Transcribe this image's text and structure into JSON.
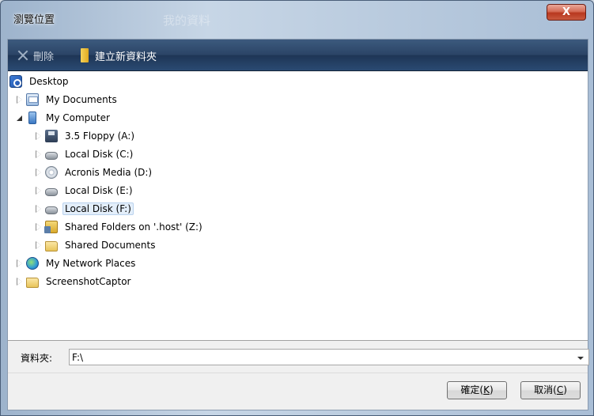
{
  "window": {
    "title": "瀏覽位置",
    "ghost_title": "我的資料",
    "close_glyph": "X"
  },
  "toolbar": {
    "delete_label": "刪除",
    "new_folder_label": "建立新資料夾"
  },
  "tree": {
    "items": [
      {
        "label": "Desktop",
        "icon": "desktop-icon",
        "expander": "none"
      },
      {
        "label": "My Documents",
        "icon": "my-documents-icon",
        "expander": "closed"
      },
      {
        "label": "My Computer",
        "icon": "computer-icon",
        "expander": "open"
      },
      {
        "label": "3.5 Floppy (A:)",
        "icon": "floppy-icon",
        "expander": "closed"
      },
      {
        "label": "Local Disk (C:)",
        "icon": "hard-disk-icon",
        "expander": "closed"
      },
      {
        "label": "Acronis Media (D:)",
        "icon": "cd-drive-icon",
        "expander": "closed"
      },
      {
        "label": "Local Disk (E:)",
        "icon": "hard-disk-icon",
        "expander": "closed"
      },
      {
        "label": "Local Disk (F:)",
        "icon": "hard-disk-icon",
        "expander": "closed",
        "selected": true
      },
      {
        "label": "Shared Folders on '.host' (Z:)",
        "icon": "network-share-icon",
        "expander": "closed"
      },
      {
        "label": "Shared Documents",
        "icon": "folder-icon",
        "expander": "closed"
      },
      {
        "label": "My Network Places",
        "icon": "network-icon",
        "expander": "closed"
      },
      {
        "label": "ScreenshotCaptor",
        "icon": "folder-icon",
        "expander": "closed"
      }
    ]
  },
  "folder": {
    "label": "資料夾:",
    "value": "F:\\"
  },
  "buttons": {
    "ok_label": "確定",
    "ok_key": "K",
    "cancel_label": "取消",
    "cancel_key": "C"
  }
}
